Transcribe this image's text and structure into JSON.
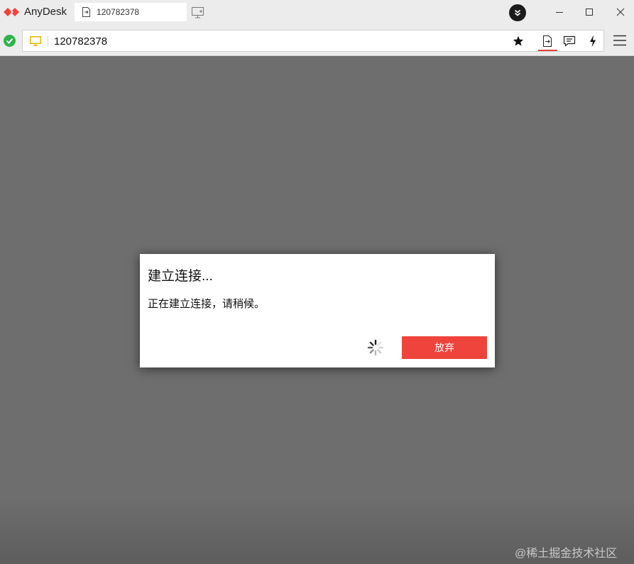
{
  "titlebar": {
    "app_name": "AnyDesk",
    "tab_label": "120782378"
  },
  "address_bar": {
    "value": "120782378"
  },
  "dialog": {
    "title": "建立连接...",
    "message": "正在建立连接，请稍候。",
    "abort_label": "放弃"
  },
  "watermark": "@稀土掘金技术社区",
  "colors": {
    "accent": "#ef443b",
    "status_ok": "#2db34a",
    "remote_bg": "#6e6e6e"
  },
  "icons": [
    "anydesk-logo",
    "file-icon",
    "new-session-icon",
    "more-icon",
    "minimize-icon",
    "maximize-icon",
    "close-icon",
    "check-icon",
    "monitor-icon",
    "star-icon",
    "file-transfer-icon",
    "chat-icon",
    "bolt-icon",
    "hamburger-menu-icon",
    "spinner-icon"
  ]
}
